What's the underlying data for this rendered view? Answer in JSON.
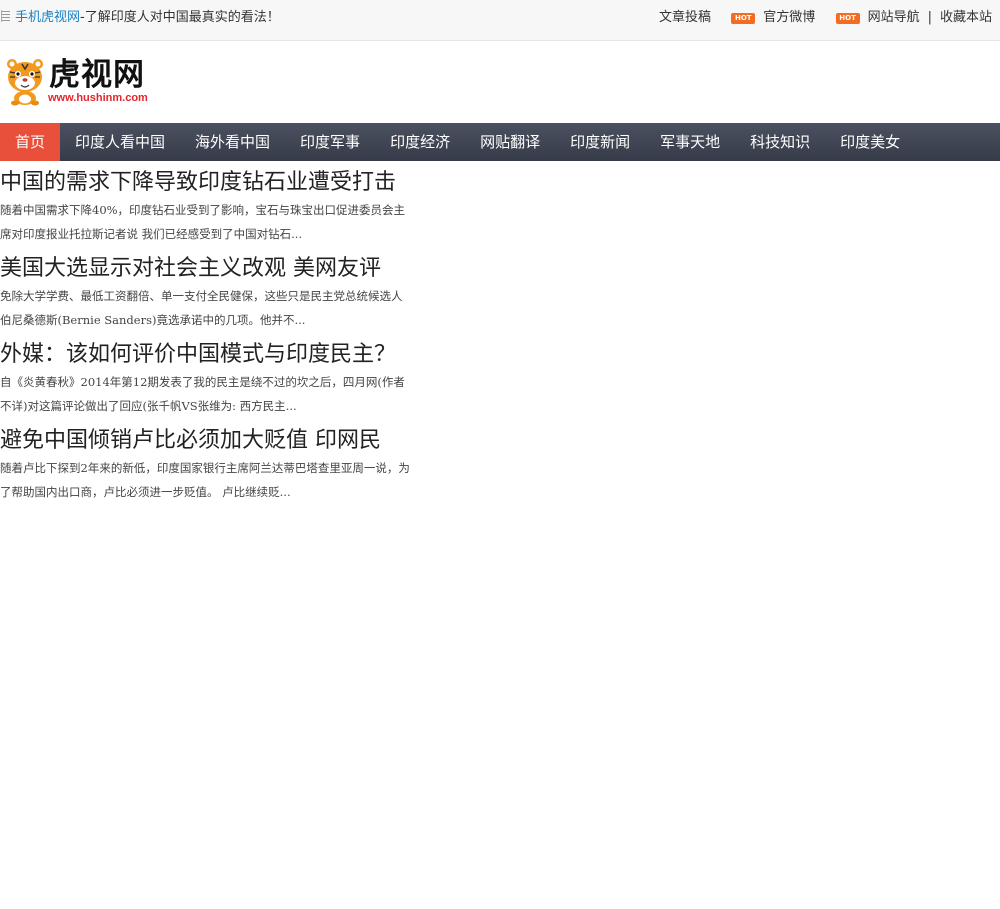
{
  "topbar": {
    "mobile_link": "手机虎视网",
    "tagline": "-了解印度人对中国最真实的看法！",
    "links": {
      "submit": "文章投稿",
      "weibo": "官方微博",
      "sitenav": "网站导航",
      "separator": "|",
      "bookmark": "收藏本站"
    },
    "hot_badge": "HOT"
  },
  "logo": {
    "name": "虎视网",
    "url_text": "www.hushinm.com"
  },
  "nav": {
    "items": [
      {
        "label": "首页",
        "active": true
      },
      {
        "label": "印度人看中国"
      },
      {
        "label": "海外看中国"
      },
      {
        "label": "印度军事"
      },
      {
        "label": "印度经济"
      },
      {
        "label": "网贴翻译"
      },
      {
        "label": "印度新闻"
      },
      {
        "label": "军事天地"
      },
      {
        "label": "科技知识"
      },
      {
        "label": "印度美女"
      }
    ]
  },
  "articles": [
    {
      "title": "中国的需求下降导致印度钻石业遭受打击",
      "summary": "随着中国需求下降40%，印度钻石业受到了影响，宝石与珠宝出口促进委员会主席对印度报业托拉斯记者说 我们已经感受到了中国对钻石..."
    },
    {
      "title": "美国大选显示对社会主义改观 美网友评",
      "summary": "免除大学学费、最低工资翻倍、单一支付全民健保，这些只是民主党总统候选人伯尼桑德斯(Bernie Sanders)竟选承诺中的几项。他并不..."
    },
    {
      "title": "外媒：该如何评价中国模式与印度民主？",
      "summary": "自《炎黄春秋》2014年第12期发表了我的民主是绕不过的坎之后，四月网(作者不详)对这篇评论做出了回应(张千帆VS张维为: 西方民主..."
    },
    {
      "title": "避免中国倾销卢比必须加大贬值 印网民",
      "summary": "随着卢比下探到2年来的新低，印度国家银行主席阿兰达蒂巴塔查里亚周一说，为了帮助国内出口商，卢比必须进一步贬值。 卢比继续贬..."
    }
  ],
  "colors": {
    "nav_bg": "#3f4452",
    "nav_active": "#e9503c",
    "link_blue": "#1a82c4",
    "hot_orange": "#f36c21",
    "logo_url_red": "#e3262c"
  }
}
